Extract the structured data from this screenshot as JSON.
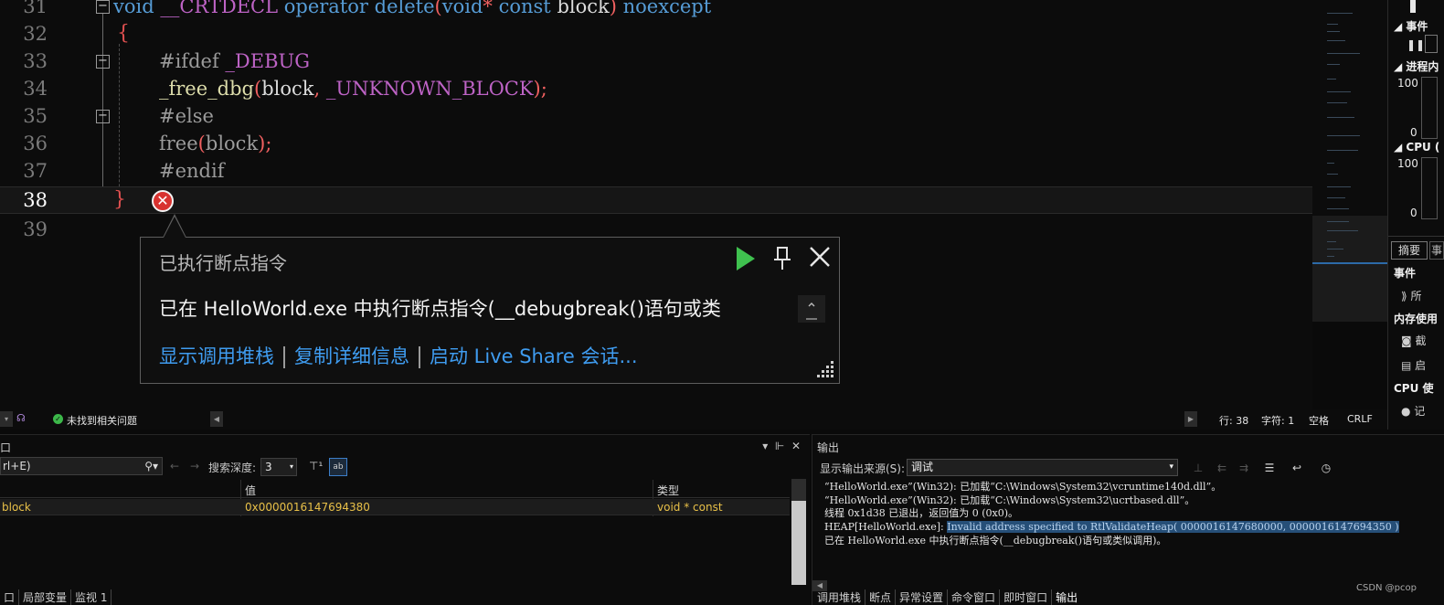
{
  "editor": {
    "lines": [
      {
        "num": "31"
      },
      {
        "num": "32"
      },
      {
        "num": "33"
      },
      {
        "num": "34"
      },
      {
        "num": "35"
      },
      {
        "num": "36"
      },
      {
        "num": "37"
      },
      {
        "num": "38"
      },
      {
        "num": "39"
      }
    ],
    "code": {
      "l31_kw1": "void",
      "l31_macro": "__CRTDECL",
      "l31_kw2": "operator",
      "l31_kw3": "delete",
      "l31_kw4": "void",
      "l31_kw5": "const",
      "l31_id": "block",
      "l31_kw6": "noexcept",
      "l32": "{",
      "l33_pp": "#ifdef",
      "l33_macro": "_DEBUG",
      "l34_fn": "_free_dbg",
      "l34_arg1": "block",
      "l34_macro": "_UNKNOWN_BLOCK",
      "l35_pp": "#else",
      "l36_fn": "free",
      "l36_arg": "block",
      "l37_pp": "#endif",
      "l38": "}"
    }
  },
  "exception_popup": {
    "title": "已执行断点指令",
    "message": "已在 HelloWorld.exe 中执行断点指令(__debugbreak()语句或类",
    "links": [
      "显示调用堆栈",
      "复制详细信息",
      "启动 Live Share 会话..."
    ]
  },
  "diagnostics": {
    "events_header": "事件",
    "process_memory_header": "进程内",
    "mem_max": "100",
    "mem_min": "0",
    "cpu_header": "CPU (",
    "cpu_max": "100",
    "cpu_min": "0",
    "tab_summary": "摘要",
    "tab_other": "事",
    "section_events": "事件",
    "events_item": "所",
    "section_memory": "内存使用",
    "memory_item_1": "截",
    "memory_item_2": "启",
    "section_cpu": "CPU 使",
    "cpu_item": "记"
  },
  "status_bar": {
    "issues": "未找到相关问题",
    "line": "行: 38",
    "col": "字符: 1",
    "whitespace": "空格",
    "eol": "CRLF"
  },
  "autos_window": {
    "title_fragment": "口",
    "search_placeholder": "rl+E)",
    "depth_label": "搜索深度:",
    "depth_value": "3",
    "columns": {
      "name": "",
      "value": "值",
      "type": "类型"
    },
    "rows": [
      {
        "name": "block",
        "value": "0x0000016147694380",
        "type": "void * const"
      }
    ],
    "tabs": [
      "口",
      "局部变量",
      "监视 1"
    ]
  },
  "output_window": {
    "title": "输出",
    "source_label": "显示输出来源(S):",
    "source_value": "调试",
    "lines": [
      "“HelloWorld.exe”(Win32): 已加载“C:\\Windows\\System32\\vcruntime140d.dll”。",
      "“HelloWorld.exe”(Win32): 已加载“C:\\Windows\\System32\\ucrtbased.dll”。",
      "线程 0x1d38 已退出，返回值为 0 (0x0)。"
    ],
    "heap_prefix": "HEAP[HelloWorld.exe]: ",
    "heap_highlight": "Invalid address specified to RtlValidateHeap( 0000016147680000, 0000016147694350 )",
    "last_line": "已在 HelloWorld.exe 中执行断点指令(__debugbreak()语句或类似调用)。",
    "tabs": [
      "调用堆栈",
      "断点",
      "异常设置",
      "命令窗口",
      "即时窗口",
      "输出"
    ],
    "watermark": "CSDN @pcop"
  },
  "colors": {
    "keyword": "#569cd6",
    "macro": "#bd63c5",
    "function": "#dcdcaa",
    "error": "#d8322f",
    "link": "#3f9cf0",
    "success": "#3cb84a",
    "highlight": "#264f78"
  }
}
